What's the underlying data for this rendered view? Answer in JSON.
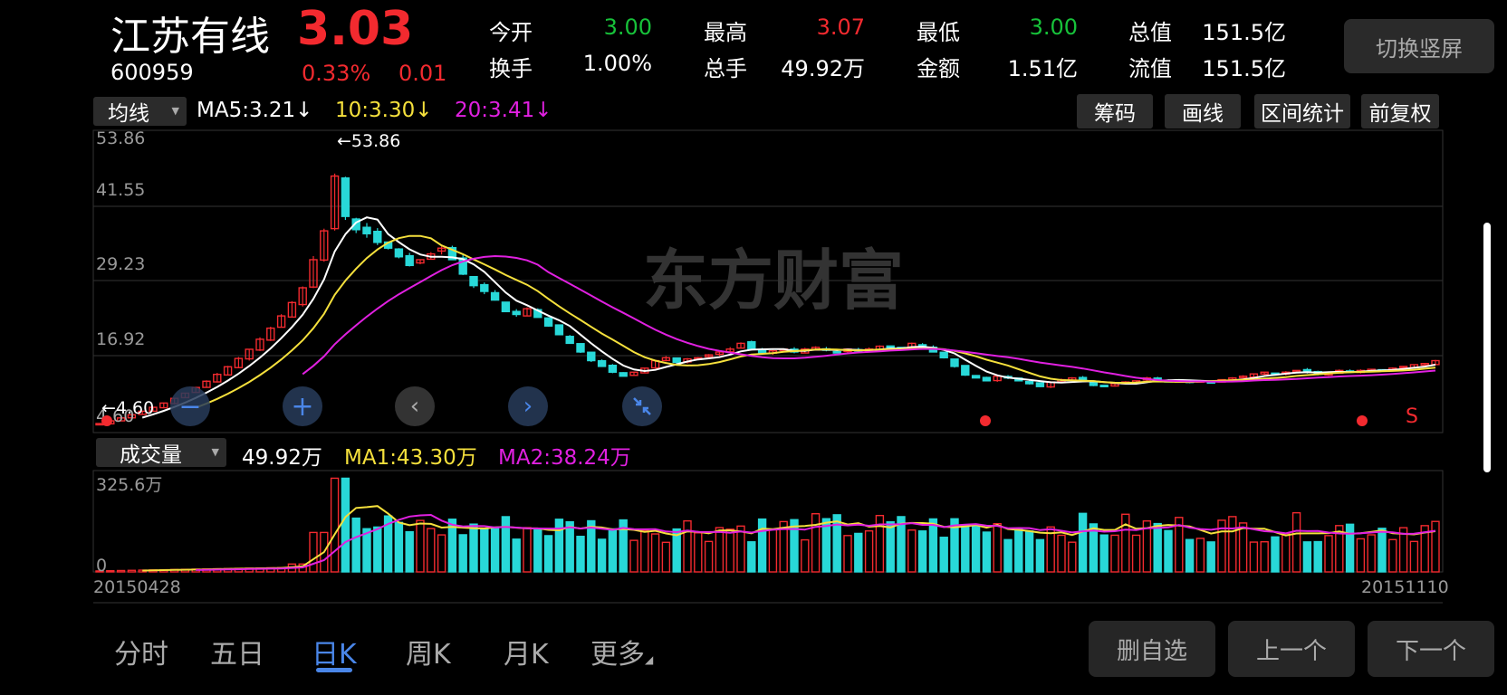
{
  "header": {
    "name": "江苏有线",
    "price": "3.03",
    "code": "600959",
    "pct": "0.33%",
    "change": "0.01",
    "quotes": [
      {
        "label": "今开",
        "value": "3.00",
        "color": "green"
      },
      {
        "label": "最高",
        "value": "3.07",
        "color": "red"
      },
      {
        "label": "最低",
        "value": "3.00",
        "color": "green"
      },
      {
        "label": "总值",
        "value": "151.5亿",
        "color": "white"
      },
      {
        "label": "换手",
        "value": "1.00%",
        "color": "white"
      },
      {
        "label": "总手",
        "value": "49.92万",
        "color": "white"
      },
      {
        "label": "金额",
        "value": "1.51亿",
        "color": "white"
      },
      {
        "label": "流值",
        "value": "151.5亿",
        "color": "white"
      }
    ],
    "switch_label": "切换竖屏"
  },
  "kchart": {
    "indicator": "均线",
    "ma5": "MA5:3.21",
    "ma10": "10:3.30",
    "ma20": "20:3.41",
    "arrow": "↓",
    "buttons": [
      "筹码",
      "画线",
      "区间统计",
      "前复权"
    ],
    "y_labels": [
      "53.86",
      "41.55",
      "29.23",
      "16.92",
      "4.60"
    ],
    "max_label": "←53.86",
    "min_label": "←4.60",
    "watermark": "东方财富",
    "signal_s": "S"
  },
  "volume": {
    "indicator": "成交量",
    "current": "49.92万",
    "ma1": "MA1:43.30万",
    "ma2": "MA2:38.24万",
    "y_max": "325.6万",
    "y_min": "0",
    "date_start": "20150428",
    "date_end": "20151110"
  },
  "tabs": [
    "分时",
    "五日",
    "日K",
    "周K",
    "月K",
    "更多"
  ],
  "active_tab": "日K",
  "bottom_buttons": [
    "删自选",
    "上一个",
    "下一个"
  ],
  "colors": {
    "up": "#f32a2f",
    "down": "#28d8d8",
    "ma5": "#ffffff",
    "ma10": "#f5e03c",
    "ma20": "#e020e0"
  },
  "chart_data": {
    "type": "candlestick",
    "x_range": [
      "20150428",
      "20151110"
    ],
    "ylim": [
      4.6,
      53.86
    ],
    "close": [
      4.6,
      5.06,
      5.57,
      6.12,
      6.73,
      7.41,
      8.15,
      8.96,
      9.86,
      10.85,
      11.93,
      13.12,
      14.44,
      15.88,
      17.47,
      19.21,
      21.13,
      23.25,
      25.57,
      28.13,
      33.0,
      38.0,
      47.5,
      40.5,
      38.2,
      37.5,
      36.0,
      35.0,
      33.5,
      32.0,
      33.0,
      34.0,
      35.0,
      33.0,
      30.5,
      28.5,
      27.5,
      26.0,
      24.0,
      23.5,
      24.5,
      23.0,
      21.5,
      20.0,
      18.5,
      17.0,
      15.5,
      14.5,
      13.5,
      12.8,
      13.5,
      14.2,
      15.5,
      16.0,
      15.2,
      15.8,
      16.0,
      16.5,
      17.0,
      17.5,
      18.5,
      17.5,
      16.8,
      17.2,
      17.5,
      17.0,
      17.5,
      17.8,
      17.3,
      17.0,
      17.5,
      17.2,
      17.5,
      18.0,
      17.8,
      17.5,
      18.5,
      17.8,
      17.0,
      16.0,
      14.5,
      13.0,
      12.5,
      12.0,
      12.8,
      12.5,
      12.0,
      11.5,
      11.0,
      11.8,
      12.2,
      12.5,
      12.0,
      11.2,
      11.0,
      11.5,
      11.8,
      12.0,
      12.5,
      12.2,
      12.0,
      12.0,
      11.8,
      12.0,
      11.8,
      12.2,
      12.5,
      12.8,
      13.2,
      13.5,
      13.2,
      13.5,
      13.8,
      13.5,
      13.2,
      13.5,
      13.8,
      13.6,
      13.8,
      14.0,
      13.8,
      14.2,
      14.5,
      14.8,
      15.0,
      15.5
    ]
  }
}
